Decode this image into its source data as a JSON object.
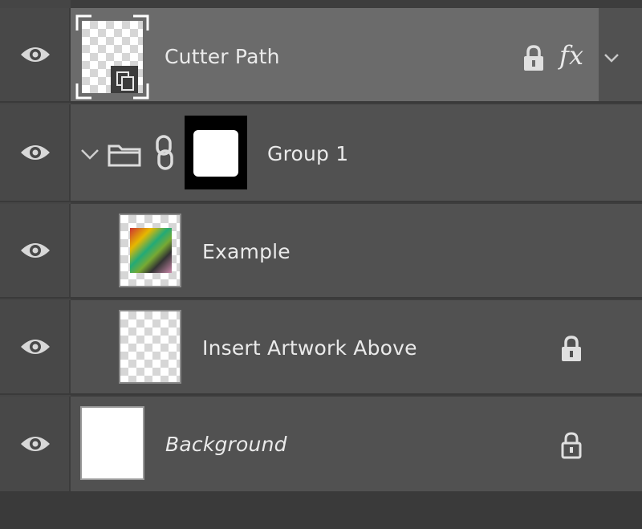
{
  "layers": [
    {
      "name": "Cutter Path",
      "fx_label": "fx",
      "selected": true,
      "locked": true
    },
    {
      "name": "Group 1",
      "type": "group",
      "expanded": true,
      "has_mask": true
    },
    {
      "name": "Example"
    },
    {
      "name": "Insert Artwork Above",
      "locked": true
    },
    {
      "name": "Background",
      "italic": true,
      "locked": true
    }
  ],
  "icons": {
    "visibility": "eye-icon",
    "lock": "lock-icon",
    "folder": "folder-icon",
    "chain": "chain-link-icon",
    "smart_object": "smart-object-badge-icon"
  },
  "colors": {
    "panel_bg": "#515151",
    "selected_bg": "#6b6b6b",
    "text": "#eaeaea"
  }
}
